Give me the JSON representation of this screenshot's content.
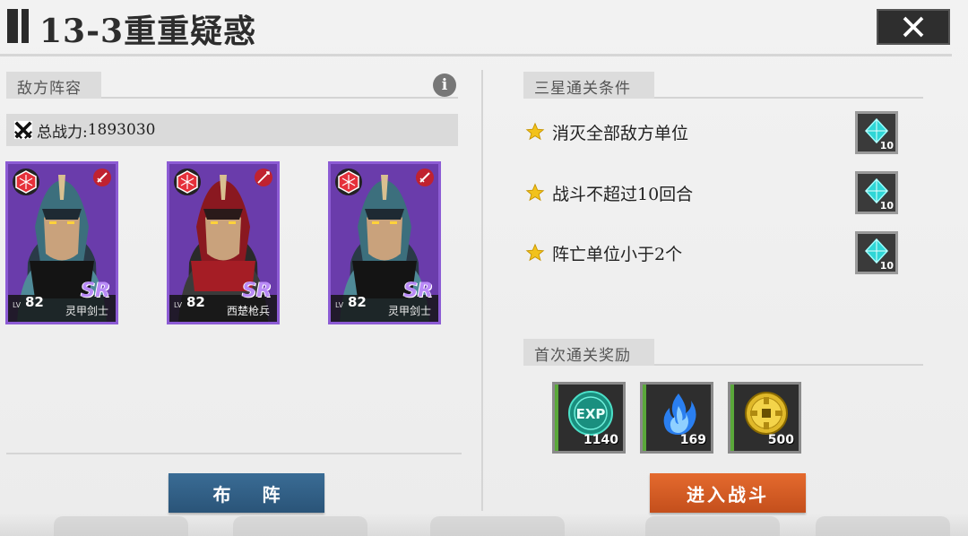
{
  "header": {
    "title": "13-3重重疑惑"
  },
  "enemy_section": {
    "label": "敌方阵容",
    "info_icon": "i",
    "total_power_label": "总战力:",
    "total_power_value": "1893030",
    "units": [
      {
        "level_prefix": "LV",
        "level": "82",
        "rarity": "SR",
        "name": "灵甲剑士",
        "color": "#6e3fb0"
      },
      {
        "level_prefix": "LV",
        "level": "82",
        "rarity": "SR",
        "name": "西楚枪兵",
        "color": "#6e3fb0"
      },
      {
        "level_prefix": "LV",
        "level": "82",
        "rarity": "SR",
        "name": "灵甲剑士",
        "color": "#6e3fb0"
      }
    ],
    "formation_button": "布 阵"
  },
  "three_star_section": {
    "label": "三星通关条件",
    "conditions": [
      {
        "text": "消灭全部敌方单位",
        "reward_qty": "10",
        "reward_icon": "crystal-icon"
      },
      {
        "text": "战斗不超过10回合",
        "reward_qty": "10",
        "reward_icon": "crystal-icon"
      },
      {
        "text": "阵亡单位小于2个",
        "reward_qty": "10",
        "reward_icon": "crystal-icon"
      }
    ]
  },
  "first_clear_section": {
    "label": "首次通关奖励",
    "rewards": [
      {
        "icon": "exp-icon",
        "text": "EXP",
        "qty": "1140"
      },
      {
        "icon": "blue-flame-icon",
        "qty": "169"
      },
      {
        "icon": "gold-coin-icon",
        "qty": "500"
      }
    ]
  },
  "battle_button": "进入战斗",
  "colors": {
    "formation_button": "#2a5478",
    "battle_button": "#d85a22",
    "card_purple": "#6e3fb0",
    "star_yellow": "#f2c21b"
  }
}
